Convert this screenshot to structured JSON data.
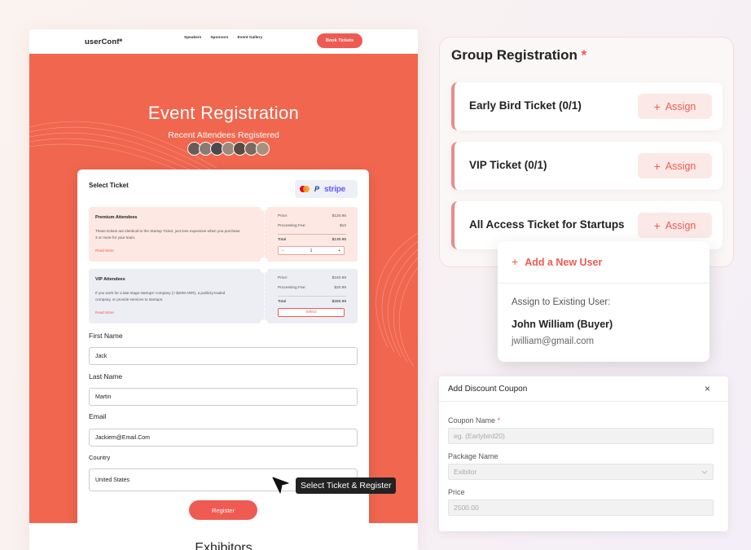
{
  "site": {
    "logo": "userConf*",
    "nav": [
      "Speakers",
      "Sponsors",
      "Event Gallery"
    ],
    "book_label": "Book Tickets",
    "hero_title": "Event Registration",
    "hero_sub": "Recent Attendees Registered",
    "avatar_colors": [
      "#6b5a55",
      "#8a7a70",
      "#4a4a4a",
      "#9b8a7a",
      "#5a4a44",
      "#7a6a60",
      "#a89080"
    ],
    "card": {
      "title": "Select Ticket",
      "payment": {
        "paypal": "P",
        "stripe": "stripe"
      },
      "tickets": [
        {
          "name": "Premium Attendees",
          "desc": "These tickets are identical to the Startup Ticket, just less expensive when you purchase 3 or more for your team.",
          "more": "Read More",
          "price_label": "Price:",
          "price": "$120.95",
          "fee_label": "Processing Fee:",
          "fee": "$10",
          "total_label": "Total",
          "total": "$130.95",
          "qty": "1",
          "minus": "−",
          "plus": "+"
        },
        {
          "name": "VIP Attendees",
          "desc": "If you work for a late-stage startups' company (> $20M ARR), a publicly-traded company, or provide services to startups.",
          "more": "Read More",
          "price_label": "Price:",
          "price": "$240.99",
          "fee_label": "Processing Fee:",
          "fee": "$20.99",
          "total_label": "Total",
          "total": "$260.99",
          "select_label": "Select"
        }
      ],
      "fields": {
        "first_name_label": "First Name",
        "first_name": "Jack",
        "last_name_label": "Last Name",
        "last_name": "Martin",
        "email_label": "Email",
        "email": "Jackiem@Email.Com",
        "country_label": "Country",
        "country": "United States"
      },
      "register_label": "Register"
    },
    "exhibitors_title": "Exhibitors"
  },
  "tooltip": "Select Ticket & Register",
  "group": {
    "title": "Group Registration",
    "star": "*",
    "tickets": [
      {
        "name": "Early Bird Ticket (0/1)",
        "assign": "Assign"
      },
      {
        "name": "VIP Ticket (0/1)",
        "assign": "Assign"
      },
      {
        "name": "All Access Ticket for Startups",
        "assign": "Assign"
      }
    ],
    "plus": "+",
    "dropdown": {
      "add_user": "Add a New User",
      "existing_label": "Assign to Existing User:",
      "user_name": "John William (Buyer)",
      "user_email": "jwilliam@gmail.com"
    }
  },
  "coupon": {
    "title": "Add Discount Coupon",
    "close": "×",
    "coupon_name_label": "Coupon Name",
    "required": "*",
    "coupon_name_placeholder": "eg. (Earlybird20)",
    "package_label": "Package Name",
    "package_value": "Exibitor",
    "price_label": "Price",
    "price_value": "2500.00"
  },
  "colors": {
    "accent": "#ef5a52",
    "hero": "#f1664e"
  }
}
